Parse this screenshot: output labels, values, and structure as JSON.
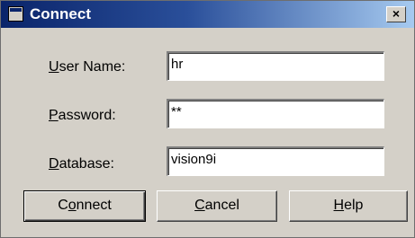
{
  "window": {
    "title": "Connect",
    "close_glyph": "×"
  },
  "form": {
    "username": {
      "label_prefix": "",
      "label_hotkey": "U",
      "label_rest": "ser Name:",
      "value": "hr"
    },
    "password": {
      "label_prefix": "",
      "label_hotkey": "P",
      "label_rest": "assword:",
      "value": "**"
    },
    "database": {
      "label_prefix": "",
      "label_hotkey": "D",
      "label_rest": "atabase:",
      "value": "vision9i"
    }
  },
  "buttons": {
    "connect": {
      "prefix": "C",
      "hotkey": "o",
      "rest": "nnect"
    },
    "cancel": {
      "prefix": "",
      "hotkey": "C",
      "rest": "ancel"
    },
    "help": {
      "prefix": "",
      "hotkey": "H",
      "rest": "elp"
    }
  },
  "colors": {
    "titlebar_start": "#0a246a",
    "titlebar_end": "#a6caf0",
    "dialog_face": "#d4d0c8"
  }
}
